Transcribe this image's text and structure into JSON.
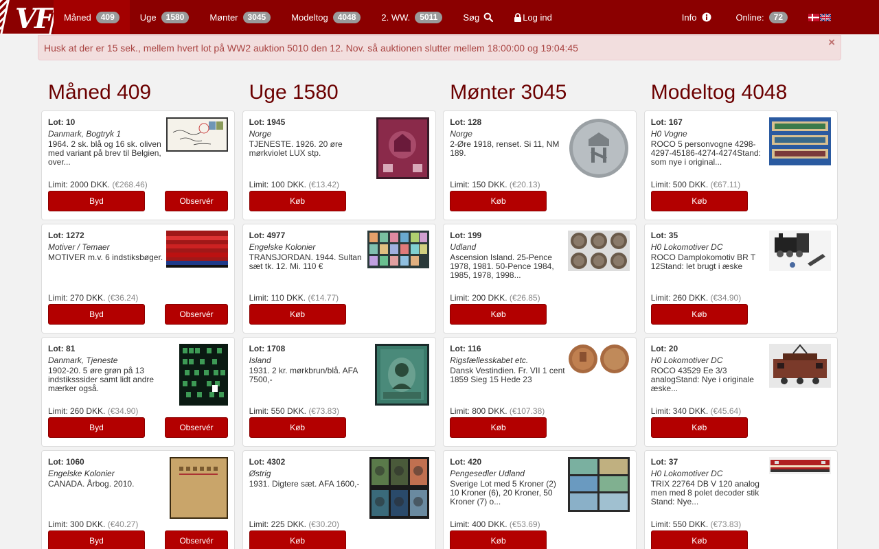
{
  "nav": {
    "logo": "VF",
    "items": [
      {
        "label": "Måned",
        "badge": "409"
      },
      {
        "label": "Uge",
        "badge": "1580"
      },
      {
        "label": "Mønter",
        "badge": "3045"
      },
      {
        "label": "Modeltog",
        "badge": "4048"
      },
      {
        "label": "2. WW.",
        "badge": "5011"
      },
      {
        "label": "Søg"
      },
      {
        "label": "Log ind"
      }
    ],
    "info": "Info",
    "online": "Online:",
    "online_badge": "72"
  },
  "alert": {
    "text": "Husk at der er 15 sek., mellem hvert lot på WW2 auktion 5010 den 12. Nov. så auktionen slutter mellem 18:00:00 og 19:04:45",
    "close": "×"
  },
  "columns": [
    {
      "title": "Måned 409",
      "lots": [
        {
          "lot": "Lot: 10",
          "cat": "Danmark, Bogtryk 1",
          "desc": "1964. 2 sk. blå og 16 sk. oliven med variant på brev til Belgien, over...",
          "limit": "Limit: 2000 DKK.",
          "eur": "(€268.46)",
          "btn1": "Byd",
          "btn2": "Observér"
        },
        {
          "lot": "Lot: 1272",
          "cat": "Motiver / Temaer",
          "desc": "MOTIVER m.v. 6 indstiksbøger.",
          "limit": "Limit: 270 DKK.",
          "eur": "(€36.24)",
          "btn1": "Byd",
          "btn2": "Observér"
        },
        {
          "lot": "Lot: 81",
          "cat": "Danmark, Tjeneste",
          "desc": "1902-20. 5 øre grøn på 13 indstiksssider samt lidt andre mærker også.",
          "limit": "Limit: 260 DKK.",
          "eur": "(€34.90)",
          "btn1": "Byd",
          "btn2": "Observér"
        },
        {
          "lot": "Lot: 1060",
          "cat": "Engelske Kolonier",
          "desc": "CANADA. Årbog. 2010.",
          "limit": "Limit: 300 DKK.",
          "eur": "(€40.27)",
          "btn1": "Byd",
          "btn2": "Observér"
        }
      ]
    },
    {
      "title": "Uge 1580",
      "lots": [
        {
          "lot": "Lot: 1945",
          "cat": "Norge",
          "desc": "TJENESTE. 1926. 20 øre mørkviolet LUX stp.",
          "limit": "Limit: 100 DKK.",
          "eur": "(€13.42)",
          "btn1": "Køb"
        },
        {
          "lot": "Lot: 4977",
          "cat": "Engelske Kolonier",
          "desc": "TRANSJORDAN. 1944. Sultan sæt tk. 12. Mi. 110 €",
          "limit": "Limit: 110 DKK.",
          "eur": "(€14.77)",
          "btn1": "Køb"
        },
        {
          "lot": "Lot: 1708",
          "cat": "Island",
          "desc": "1931. 2 kr. mørkbrun/blå. AFA 7500,-",
          "limit": "Limit: 550 DKK.",
          "eur": "(€73.83)",
          "btn1": "Køb"
        },
        {
          "lot": "Lot: 4302",
          "cat": "Østrig",
          "desc": "1931. Digtere sæt. AFA 1600,-",
          "limit": "Limit: 225 DKK.",
          "eur": "(€30.20)",
          "btn1": "Køb"
        }
      ]
    },
    {
      "title": "Mønter 3045",
      "lots": [
        {
          "lot": "Lot: 128",
          "cat": "Norge",
          "desc": "2-Øre 1918, renset. Si 11, NM 189.",
          "limit": "Limit: 150 DKK.",
          "eur": "(€20.13)",
          "btn1": "Køb"
        },
        {
          "lot": "Lot: 199",
          "cat": "Udland",
          "desc": "Ascension Island. 25-Pence 1978, 1981. 50-Pence 1984, 1985, 1978, 1998...",
          "limit": "Limit: 200 DKK.",
          "eur": "(€26.85)",
          "btn1": "Køb"
        },
        {
          "lot": "Lot: 116",
          "cat": "Rigsfællesskabet etc.",
          "desc": "Dansk Vestindien. Fr. VII 1 cent 1859 Sieg 15 Hede 23",
          "limit": "Limit: 800 DKK.",
          "eur": "(€107.38)",
          "btn1": "Køb"
        },
        {
          "lot": "Lot: 420",
          "cat": "Pengesedler Udland",
          "desc": "Sverige Lot med 5 Kroner (2) 10 Kroner (6), 20 Kroner, 50 Kroner (7) o...",
          "limit": "Limit: 400 DKK.",
          "eur": "(€53.69)",
          "btn1": "Køb"
        }
      ]
    },
    {
      "title": "Modeltog 4048",
      "lots": [
        {
          "lot": "Lot: 167",
          "cat": "H0 Vogne",
          "desc": "ROCO 5 personvogne 4298-4297-45186-4274-4274Stand: som nye i original...",
          "limit": "Limit: 500 DKK.",
          "eur": "(€67.11)",
          "btn1": "Køb"
        },
        {
          "lot": "Lot: 35",
          "cat": "H0 Lokomotiver DC",
          "desc": "ROCO Damplokomotiv BR T 12Stand: let brugt i æske",
          "limit": "Limit: 260 DKK.",
          "eur": "(€34.90)",
          "btn1": "Køb"
        },
        {
          "lot": "Lot: 20",
          "cat": "H0 Lokomotiver DC",
          "desc": "ROCO 43529 Ee 3/3 analogStand: Nye i originale æske...",
          "limit": "Limit: 340 DKK.",
          "eur": "(€45.64)",
          "btn1": "Køb"
        },
        {
          "lot": "Lot: 37",
          "cat": "H0 Lokomotiver DC",
          "desc": "TRIX 22764 DB V 120 analog men med 8 polet decoder stik Stand: Nye...",
          "limit": "Limit: 550 DKK.",
          "eur": "(€73.83)",
          "btn1": "Køb"
        }
      ]
    }
  ]
}
